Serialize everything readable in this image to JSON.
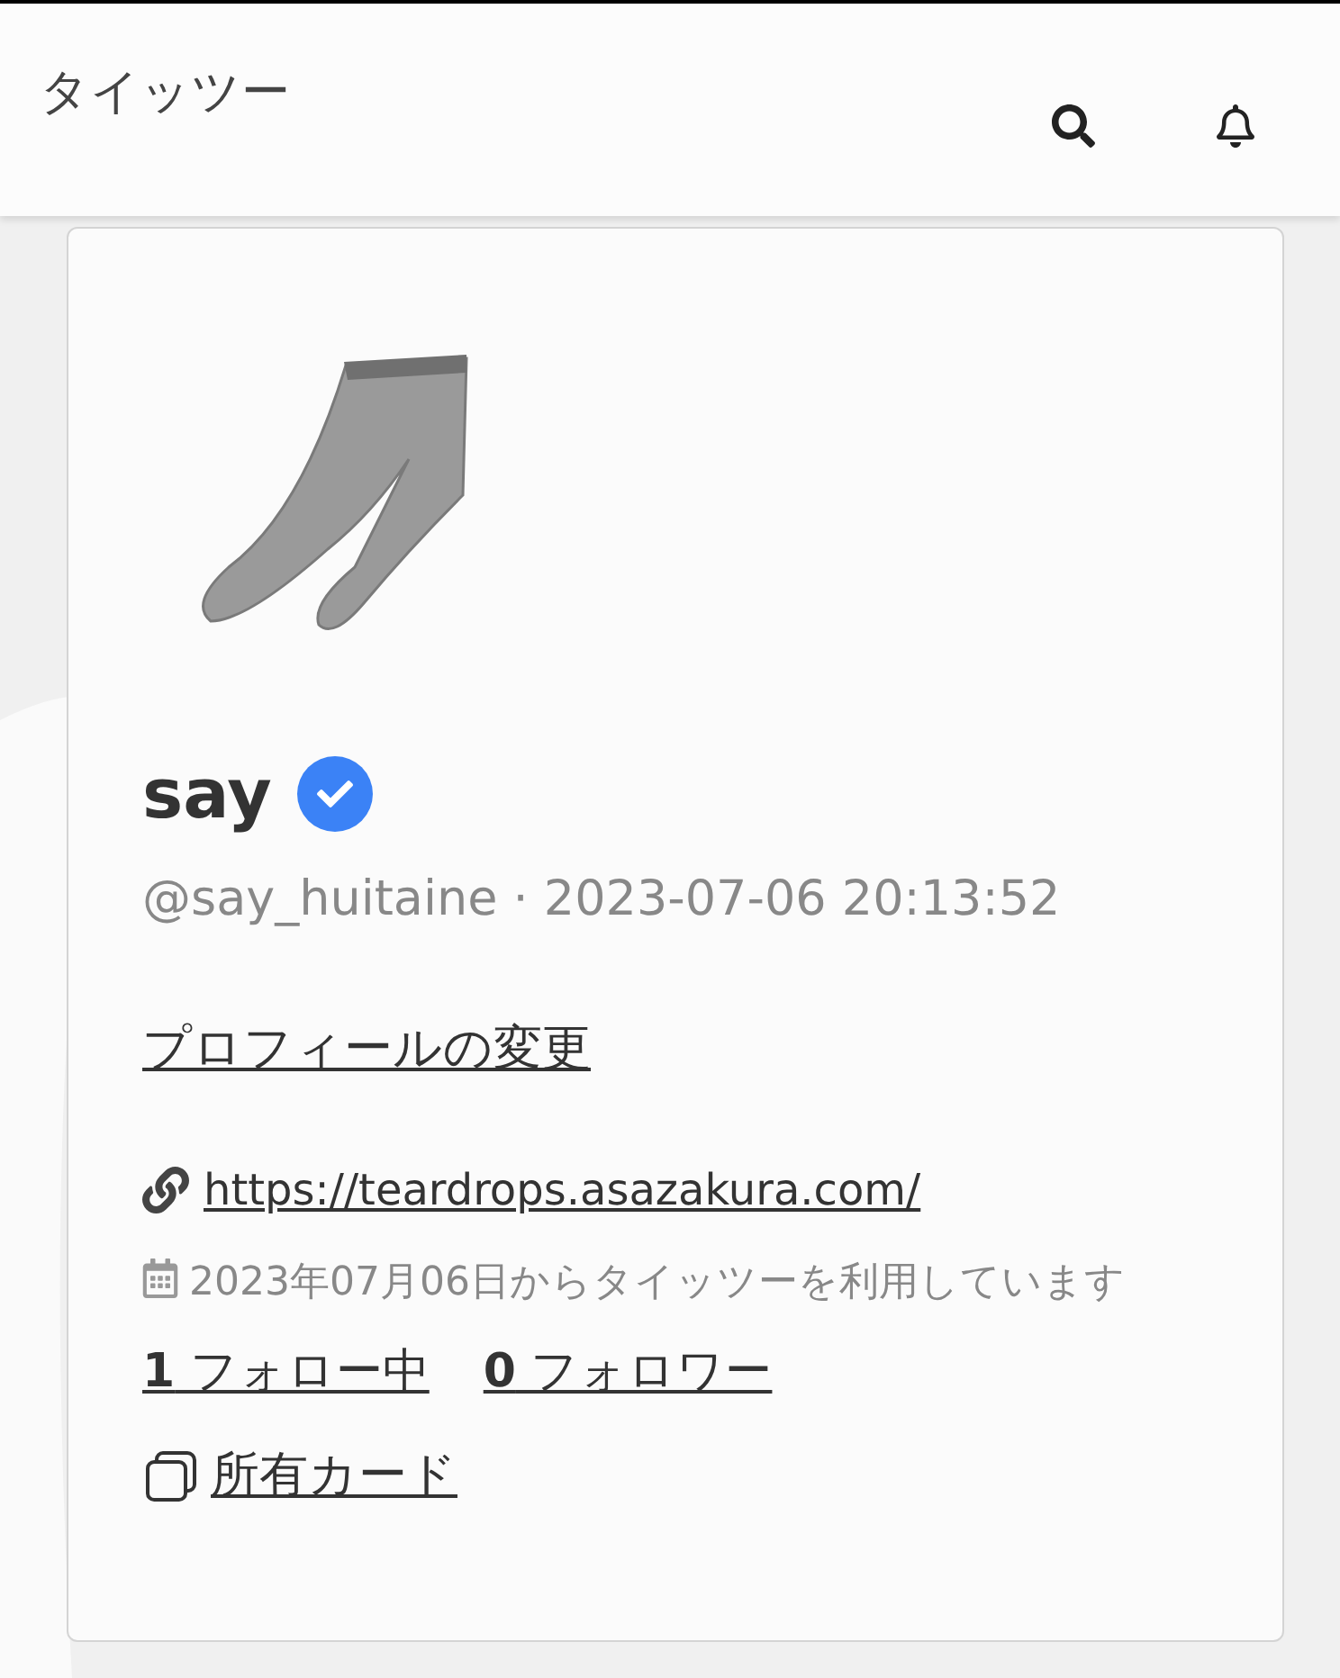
{
  "header": {
    "title": "タイッツー"
  },
  "profile": {
    "name": "say",
    "verified": true,
    "meta": "@say_huitaine · 2023-07-06 20:13:52",
    "edit_link": "プロフィールの変更",
    "url": "https://teardrops.asazakura.com/",
    "joined": "2023年07月06日からタイッツーを利用しています",
    "follow_stats": [
      "**1** フォロー中",
      "**0** フォロワー"
    ],
    "cards_link": "所有カード"
  }
}
